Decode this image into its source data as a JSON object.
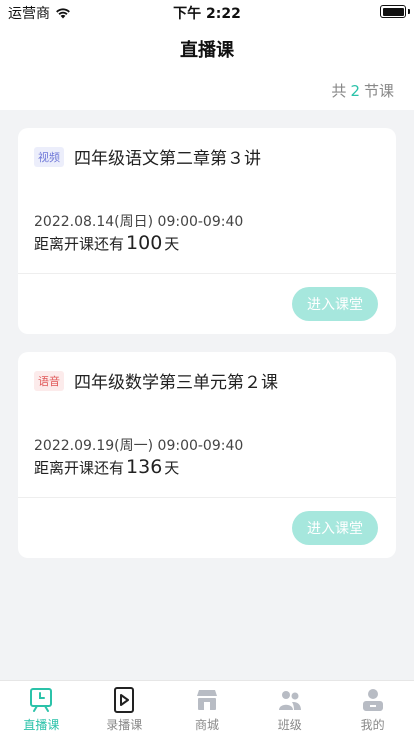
{
  "status_bar": {
    "carrier": "运营商",
    "time": "下午 2:22"
  },
  "header": {
    "title": "直播课"
  },
  "summary": {
    "prefix": "共",
    "count": "2",
    "suffix": "节课"
  },
  "courses": [
    {
      "tag": "视频",
      "title": "四年级语文第二章第３讲",
      "datetime": "2022.08.14(周日) 09:00-09:40",
      "countdown_prefix": "距离开课还有",
      "countdown_days": "100",
      "countdown_suffix": "天",
      "button_label": "进入课堂"
    },
    {
      "tag": "语音",
      "title": "四年级数学第三单元第２课",
      "datetime": "2022.09.19(周一) 09:00-09:40",
      "countdown_prefix": "距离开课还有",
      "countdown_days": "136",
      "countdown_suffix": "天",
      "button_label": "进入课堂"
    }
  ],
  "tabbar": {
    "items": [
      {
        "label": "直播课",
        "icon": "live-class-icon",
        "active": true
      },
      {
        "label": "录播课",
        "icon": "recorded-class-icon",
        "active": false
      },
      {
        "label": "商城",
        "icon": "store-icon",
        "active": false
      },
      {
        "label": "班级",
        "icon": "class-group-icon",
        "active": false
      },
      {
        "label": "我的",
        "icon": "profile-icon",
        "active": false
      }
    ]
  },
  "colors": {
    "accent": "#2bc2a9",
    "button_disabled": "#a6e7dd",
    "tag_video": "#6f78d8",
    "tag_audio": "#e05858"
  }
}
